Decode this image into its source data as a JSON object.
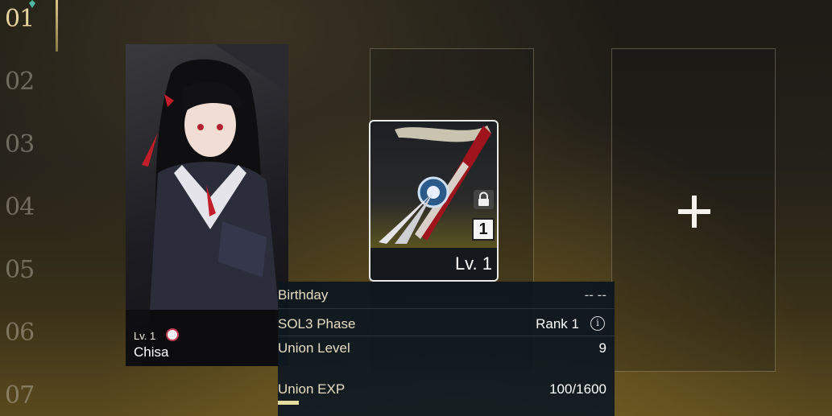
{
  "sidebar": {
    "numbers": [
      "01",
      "02",
      "03",
      "04",
      "05",
      "06",
      "07"
    ],
    "active_index": 0
  },
  "character": {
    "level": "Lv. 1",
    "name": "Chisa",
    "badge_icon": "element-badge-icon"
  },
  "weapon": {
    "level": "Lv. 1",
    "rank": "1",
    "lock_icon": "lock-icon"
  },
  "empty_slot": {
    "icon": "plus-icon"
  },
  "info": {
    "birthday_label": "Birthday",
    "birthday_value": "-- --",
    "phase_label": "SOL3 Phase",
    "phase_value": "Rank 1",
    "union_level_label": "Union Level",
    "union_level_value": "9",
    "union_exp_label": "Union EXP",
    "union_exp_value": "100/1600",
    "union_exp_progress": 0.0625
  },
  "colors": {
    "accent_gold": "#e6d4a0",
    "panel_bg": "#0e161e"
  }
}
